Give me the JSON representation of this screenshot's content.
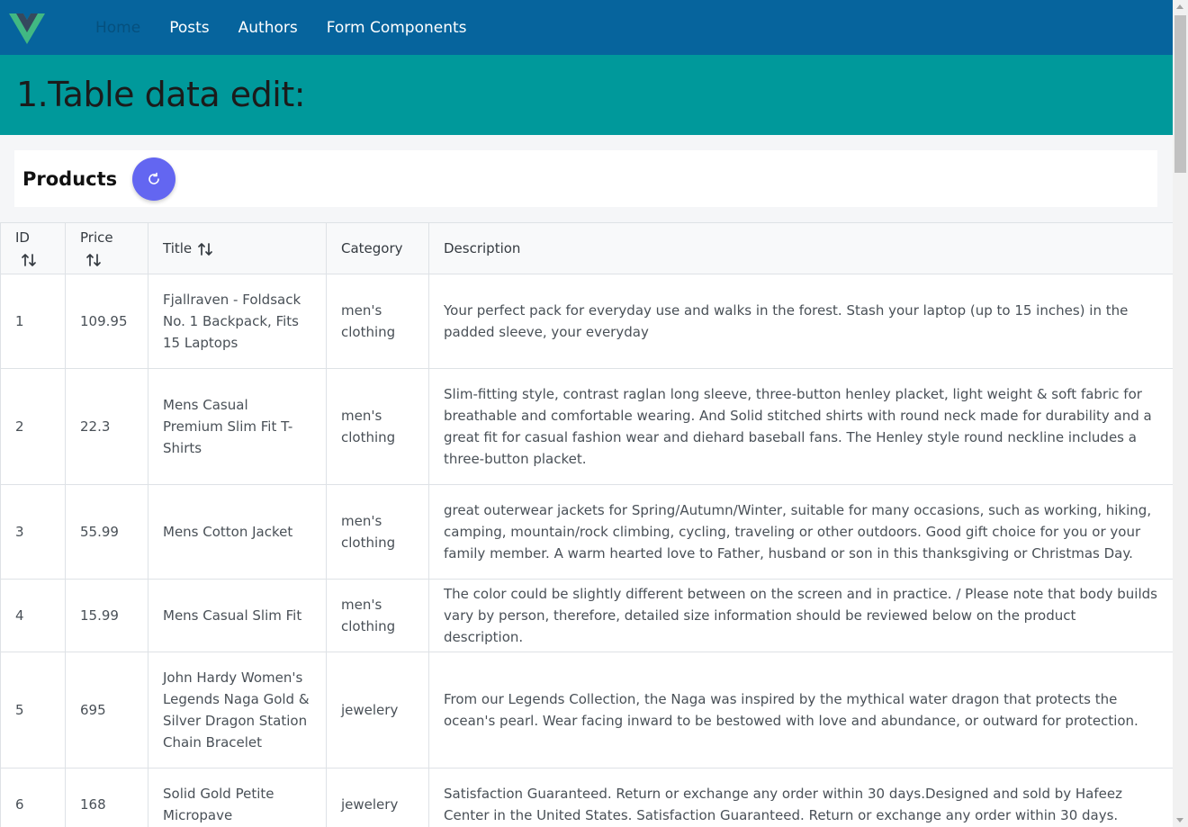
{
  "nav": {
    "logo_icon": "vue-logo-icon",
    "items": [
      {
        "label": "Home",
        "active": true
      },
      {
        "label": "Posts",
        "active": false
      },
      {
        "label": "Authors",
        "active": false
      },
      {
        "label": "Form Components",
        "active": false
      }
    ]
  },
  "hero": {
    "title": "1.Table data edit:"
  },
  "card": {
    "title": "Products",
    "refresh_icon": "refresh-icon"
  },
  "table": {
    "columns": [
      "ID",
      "Price",
      "Title",
      "Category",
      "Description"
    ],
    "rows": [
      {
        "id": "1",
        "price": "109.95",
        "title": "Fjallraven - Foldsack No. 1 Backpack, Fits 15 Laptops",
        "category": "men's clothing",
        "description": "Your perfect pack for everyday use and walks in the forest. Stash your laptop (up to 15 inches) in the padded sleeve, your everyday"
      },
      {
        "id": "2",
        "price": "22.3",
        "title": "Mens Casual Premium Slim Fit T-Shirts",
        "category": "men's clothing",
        "description": "Slim-fitting style, contrast raglan long sleeve, three-button henley placket, light weight & soft fabric for breathable and comfortable wearing. And Solid stitched shirts with round neck made for durability and a great fit for casual fashion wear and diehard baseball fans. The Henley style round neckline includes a three-button placket."
      },
      {
        "id": "3",
        "price": "55.99",
        "title": "Mens Cotton Jacket",
        "category": "men's clothing",
        "description": "great outerwear jackets for Spring/Autumn/Winter, suitable for many occasions, such as working, hiking, camping, mountain/rock climbing, cycling, traveling or other outdoors. Good gift choice for you or your family member. A warm hearted love to Father, husband or son in this thanksgiving or Christmas Day."
      },
      {
        "id": "4",
        "price": "15.99",
        "title": "Mens Casual Slim Fit",
        "category": "men's clothing",
        "description": "The color could be slightly different between on the screen and in practice. / Please note that body builds vary by person, therefore, detailed size information should be reviewed below on the product description."
      },
      {
        "id": "5",
        "price": "695",
        "title": "John Hardy Women's Legends Naga Gold & Silver Dragon Station Chain Bracelet",
        "category": "jewelery",
        "description": "From our Legends Collection, the Naga was inspired by the mythical water dragon that protects the ocean's pearl. Wear facing inward to be bestowed with love and abundance, or outward for protection."
      },
      {
        "id": "6",
        "price": "168",
        "title": "Solid Gold Petite Micropave",
        "category": "jewelery",
        "description": "Satisfaction Guaranteed. Return or exchange any order within 30 days.Designed and sold by Hafeez Center in the United States. Satisfaction Guaranteed. Return or exchange any order within 30 days."
      }
    ]
  },
  "colors": {
    "nav_bg": "#06649d",
    "hero_bg": "#00999b",
    "accent": "#6366f1"
  }
}
